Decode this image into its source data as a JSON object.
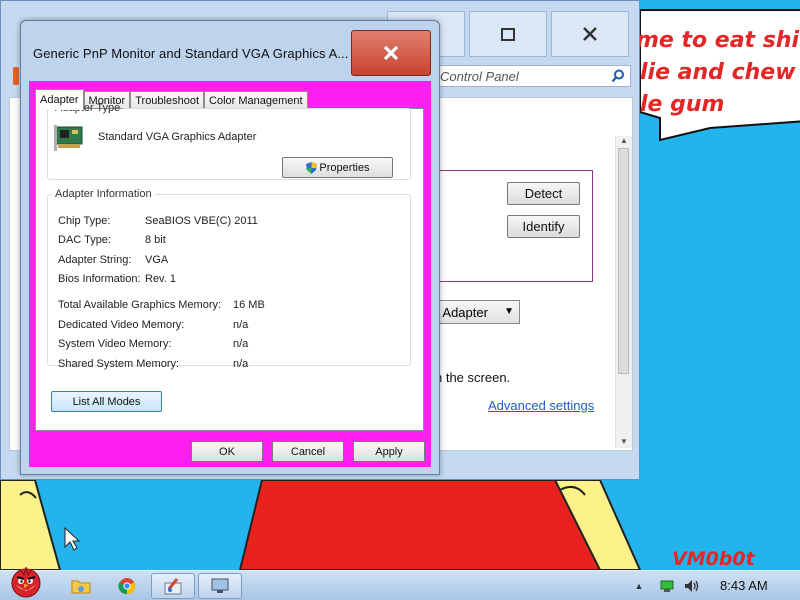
{
  "wallpaper": {
    "bubble_lines": [
      "me to eat shit",
      "lie and chew",
      "le gum"
    ],
    "watermark": "VM0b0t"
  },
  "control_panel": {
    "search_placeholder": "Control Panel",
    "detect_label": "Detect",
    "identify_label": "Identify",
    "dropdown_value": "s Adapter",
    "screen_text": "n the screen.",
    "advanced_link": "Advanced settings"
  },
  "dialog": {
    "title": "Generic PnP Monitor and Standard VGA Graphics A...",
    "tabs": [
      {
        "label": "Adapter",
        "active": true
      },
      {
        "label": "Monitor",
        "active": false
      },
      {
        "label": "Troubleshoot",
        "active": false
      },
      {
        "label": "Color Management",
        "active": false
      }
    ],
    "adapter_type": {
      "legend": "Adapter Type",
      "name": "Standard VGA Graphics Adapter",
      "properties_label": "Properties"
    },
    "adapter_info": {
      "legend": "Adapter Information",
      "rows": [
        {
          "label": "Chip Type:",
          "value": "SeaBIOS VBE(C) 2011"
        },
        {
          "label": "DAC Type:",
          "value": "8 bit"
        },
        {
          "label": "Adapter String:",
          "value": "VGA"
        },
        {
          "label": "Bios Information:",
          "value": "Rev. 1"
        }
      ],
      "memory_rows": [
        {
          "label": "Total Available Graphics Memory:",
          "value": "16 MB"
        },
        {
          "label": "Dedicated Video Memory:",
          "value": "n/a"
        },
        {
          "label": "System Video Memory:",
          "value": "n/a"
        },
        {
          "label": "Shared System Memory:",
          "value": "n/a"
        }
      ]
    },
    "list_modes_label": "List All Modes",
    "ok_label": "OK",
    "cancel_label": "Cancel",
    "apply_label": "Apply"
  },
  "taskbar": {
    "time": "8:43 AM"
  },
  "colors": {
    "desktop": "#23b4ee",
    "dialog_frame": "#ff1ff0",
    "close_red": "#c7432f",
    "link_blue": "#1c5ec8"
  }
}
